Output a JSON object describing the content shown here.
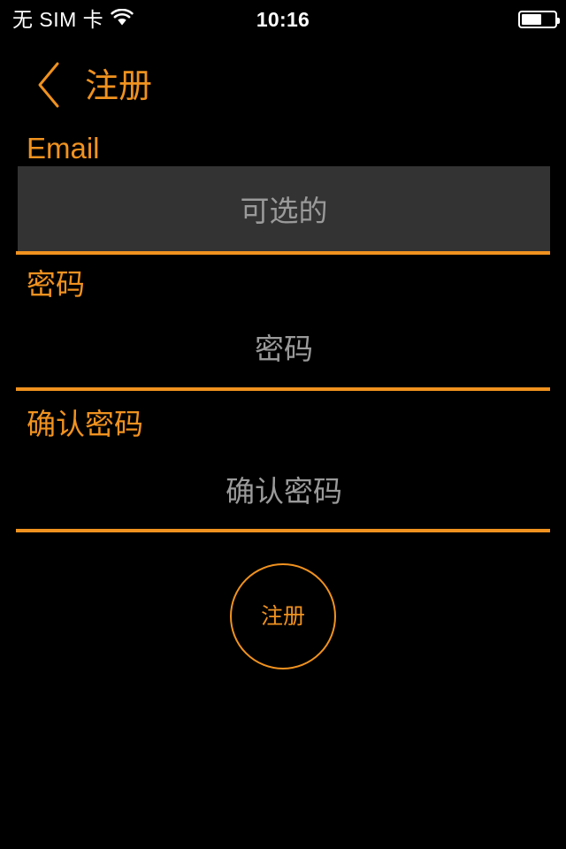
{
  "status_bar": {
    "carrier": "无 SIM 卡",
    "wifi_icon": "wifi-icon",
    "time": "10:16",
    "battery_icon": "battery-icon",
    "battery_level_percent": 62
  },
  "nav": {
    "back_icon": "chevron-left-icon",
    "title": "注册"
  },
  "form": {
    "fields": [
      {
        "label": "Email",
        "placeholder": "可选的",
        "value": "",
        "focused": true
      },
      {
        "label": "密码",
        "placeholder": "密码",
        "value": "",
        "focused": false
      },
      {
        "label": "确认密码",
        "placeholder": "确认密码",
        "value": "",
        "focused": false
      }
    ]
  },
  "submit": {
    "label": "注册"
  },
  "colors": {
    "background": "#000000",
    "accent": "#f0921f",
    "field_focus_background": "#333333",
    "placeholder_text": "#9a9a9a",
    "status_text": "#ffffff"
  }
}
